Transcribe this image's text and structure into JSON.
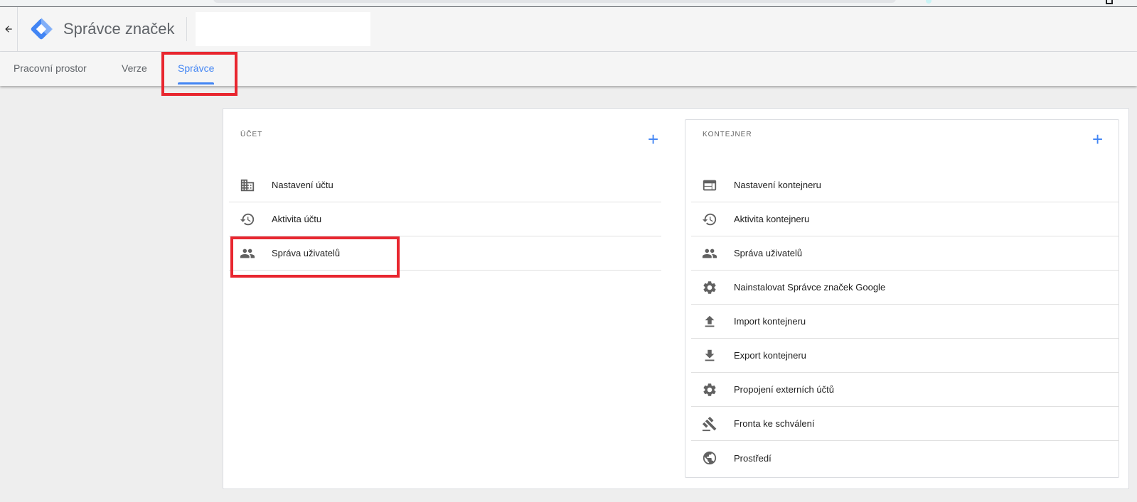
{
  "app": {
    "title": "Správce značek"
  },
  "tabs": [
    {
      "label": "Pracovní prostor",
      "active": false
    },
    {
      "label": "Verze",
      "active": false
    },
    {
      "label": "Správce",
      "active": true
    }
  ],
  "account": {
    "section_label": "ÚČET",
    "add_icon": "plus-icon",
    "items": [
      {
        "label": "Nastavení účtu",
        "icon": "building-icon"
      },
      {
        "label": "Aktivita účtu",
        "icon": "history-icon"
      },
      {
        "label": "Správa uživatelů",
        "icon": "people-icon"
      }
    ]
  },
  "container": {
    "section_label": "KONTEJNER",
    "add_icon": "plus-icon",
    "items": [
      {
        "label": "Nastavení kontejneru",
        "icon": "web-container-icon"
      },
      {
        "label": "Aktivita kontejneru",
        "icon": "history-icon"
      },
      {
        "label": "Správa uživatelů",
        "icon": "people-icon"
      },
      {
        "label": "Nainstalovat Správce značek Google",
        "icon": "gear-icon"
      },
      {
        "label": "Import kontejneru",
        "icon": "upload-icon"
      },
      {
        "label": "Export kontejneru",
        "icon": "download-icon"
      },
      {
        "label": "Propojení externích účtů",
        "icon": "gear-icon"
      },
      {
        "label": "Fronta ke schválení",
        "icon": "gavel-icon"
      },
      {
        "label": "Prostředí",
        "icon": "globe-icon"
      }
    ]
  },
  "colors": {
    "accent": "#4285f4",
    "highlight": "#e8262f"
  }
}
